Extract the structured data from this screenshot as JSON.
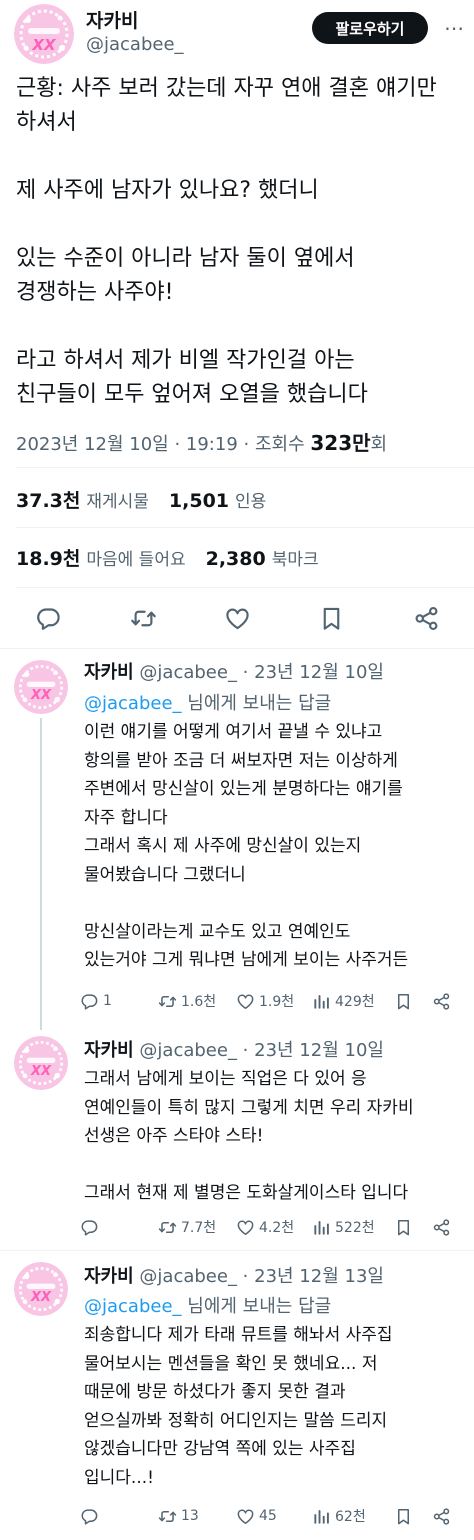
{
  "main": {
    "author_name": "자카비",
    "author_handle": "@jacabee_",
    "follow_label": "팔로우하기",
    "body": "근황: 사주 보러 갔는데 자꾸 연애 결혼 얘기만\n하셔서\n\n제 사주에 남자가 있나요? 했더니\n\n있는 수준이 아니라 남자 둘이 옆에서\n경쟁하는 사주야!\n\n라고 하셔서 제가 비엘 작가인걸 아는\n친구들이 모두 엎어져 오열을 했습니다",
    "timestamp": "2023년 12월 10일 · 19:19 · 조회수 ",
    "views_number": "323만",
    "views_suffix": "회",
    "reposts_count": "37.3천",
    "reposts_label": "재게시물",
    "quotes_count": "1,501",
    "quotes_label": "인용",
    "likes_count": "18.9천",
    "likes_label": "마음에 들어요",
    "bookmarks_count": "2,380",
    "bookmarks_label": "북마크"
  },
  "replies": [
    {
      "name": "자카비",
      "meta": "@jacabee_ · 23년 12월 10일",
      "replying_to": "@jacabee_",
      "replying_suffix": " 님에게 보내는 답글",
      "body": "이런 얘기를 어떻게 여기서 끝낼 수 있냐고\n항의를 받아 조금 더 써보자면 저는 이상하게\n주변에서 망신살이 있는게 분명하다는 얘기를\n자주 합니다\n그래서 혹시 제 사주에 망신살이 있는지\n물어봤습니다 그랬더니\n\n망신살이라는게 교수도 있고 연예인도\n있는거야 그게 뭐냐면 남에게 보이는 사주거든",
      "replies": "1",
      "reposts": "1.6천",
      "likes": "1.9천",
      "views": "429천"
    },
    {
      "name": "자카비",
      "meta": "@jacabee_ · 23년 12월 10일",
      "body": "그래서 남에게 보이는 직업은 다 있어 응\n연예인들이 특히 많지 그렇게 치면 우리 자카비\n선생은 아주 스타야 스타!\n\n그래서 현재 제 별명은 도화살게이스타 입니다",
      "replies": "",
      "reposts": "7.7천",
      "likes": "4.2천",
      "views": "522천"
    },
    {
      "name": "자카비",
      "meta": "@jacabee_ · 23년 12월 13일",
      "replying_to": "@jacabee_",
      "replying_suffix": " 님에게 보내는 답글",
      "body": "죄송합니다 제가 타래 뮤트를 해놔서 사주집\n물어보시는 멘션들을 확인 못 했네요... 저\n때문에 방문 하셨다가 좋지 못한 결과\n얻으실까봐 정확히 어디인지는 말씀 드리지\n않겠습니다만 강남역 쪽에 있는 사주집\n입니다...!",
      "replies": "",
      "reposts": "13",
      "likes": "45",
      "views": "62천"
    }
  ],
  "avatar": {
    "text": "XX",
    "bg": "#f8c6e4",
    "ring": "#f2a3d3",
    "text_color": "#ff5fb8"
  },
  "colors": {
    "accent": "#1d9bf0",
    "muted": "#536471",
    "text": "#0f1419",
    "divider": "#eff3f4"
  },
  "icons": [
    "reply-icon",
    "repost-icon",
    "like-icon",
    "bookmark-icon",
    "share-icon",
    "views-icon"
  ]
}
